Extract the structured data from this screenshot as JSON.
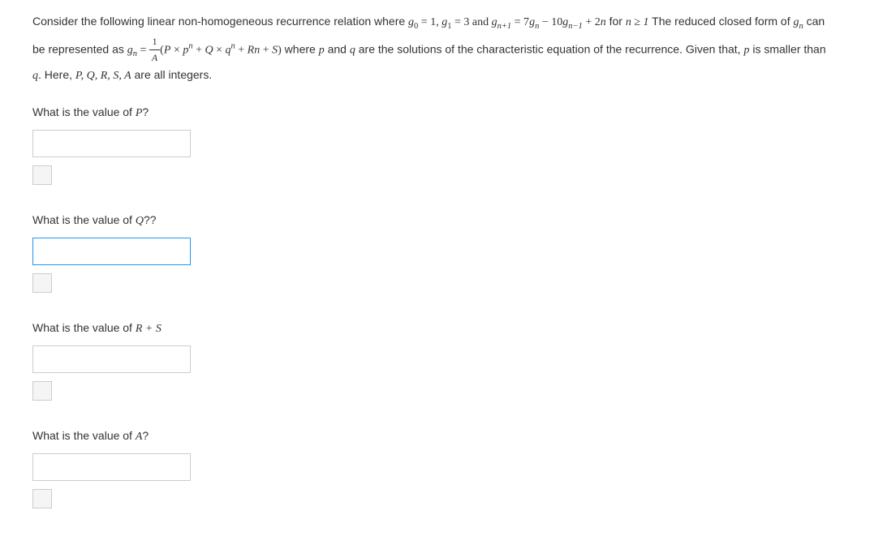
{
  "problem": {
    "intro": "Consider the following linear non-homogeneous recurrence relation where ",
    "g0": "g",
    "g0_sub": "0",
    "eq1": " = 1, ",
    "g1": "g",
    "g1_sub": "1",
    "eq2": " = 3 and ",
    "gn1": "g",
    "gn1_sub": "n+1",
    "eq3": " = 7",
    "gn": "g",
    "gn_sub": "n",
    "minus": " − 10",
    "gnm1": "g",
    "gnm1_sub": "n−1",
    "plus2n": " + 2",
    "n_var": "n",
    "for_n": " for ",
    "n_geq": "n ≥ 1",
    "reduced": " The reduced closed form of ",
    "gn2": "g",
    "gn2_sub": "n",
    "can_be": " can be represented as ",
    "gn3": "g",
    "gn3_sub": "n",
    "equals": " = ",
    "frac_num": "1",
    "frac_den": "A",
    "open_paren": "(",
    "P": "P",
    "times1": " × ",
    "p_var": "p",
    "n_sup1": "n",
    "plus1": " + ",
    "Q": "Q",
    "times2": " × ",
    "q_var": "q",
    "n_sup2": "n",
    "plus2": " + ",
    "R": "R",
    "n_var2": "n",
    "plus3": " + ",
    "S": "S",
    "close_paren": ")",
    "where": " where ",
    "p_char": "p",
    "and1": " and ",
    "q_char": "q",
    "solutions": " are the solutions of the characteristic equation of the recurrence. Given that, ",
    "p_small": "p",
    "smaller": " is smaller than ",
    "q_small": "q",
    "here": ". Here, ",
    "PQRSA": "P, Q, R, S, A",
    "integers": " are all integers."
  },
  "questions": {
    "q1_prefix": "What is the value of ",
    "q1_var": "P",
    "q1_suffix": "?",
    "q2_prefix": "What is the value of ",
    "q2_var": "Q",
    "q2_suffix": "??",
    "q3_prefix": "What is the value of ",
    "q3_var": "R + S",
    "q3_suffix": "",
    "q4_prefix": "What is the value of ",
    "q4_var": "A",
    "q4_suffix": "?"
  }
}
